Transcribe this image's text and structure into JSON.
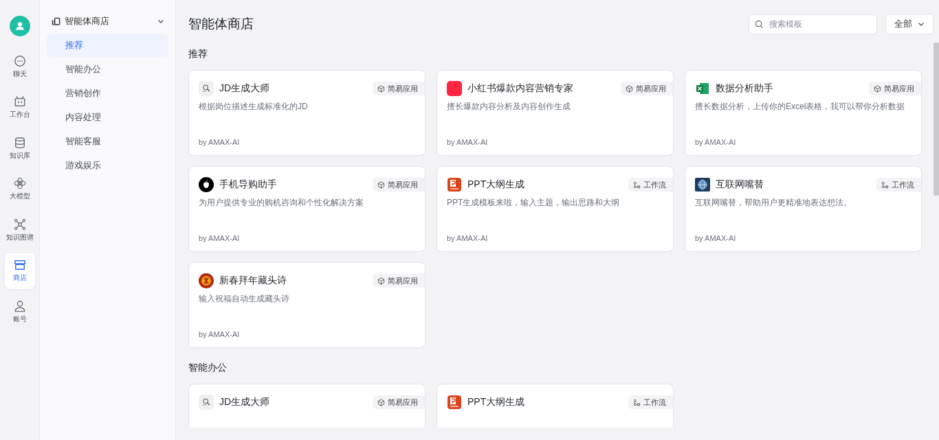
{
  "rail": {
    "items": [
      {
        "kind": "chat",
        "label": "聊天",
        "selected": false
      },
      {
        "kind": "robot",
        "label": "工作台",
        "selected": false
      },
      {
        "kind": "database",
        "label": "知识库",
        "selected": false
      },
      {
        "kind": "model",
        "label": "大模型",
        "selected": false
      },
      {
        "kind": "graph",
        "label": "知识图谱",
        "selected": false
      },
      {
        "kind": "store",
        "label": "商店",
        "selected": true
      },
      {
        "kind": "user",
        "label": "账号",
        "selected": false
      }
    ]
  },
  "sidebar": {
    "title": "智能体商店",
    "expanded": true,
    "items": [
      {
        "label": "推荐",
        "selected": true
      },
      {
        "label": "智能办公",
        "selected": false
      },
      {
        "label": "营销创作",
        "selected": false
      },
      {
        "label": "内容处理",
        "selected": false
      },
      {
        "label": "智能客服",
        "selected": false
      },
      {
        "label": "游戏娱乐",
        "selected": false
      }
    ]
  },
  "header": {
    "title": "智能体商店",
    "search": {
      "placeholder": "搜索模板"
    },
    "filter": "全部"
  },
  "sections": [
    {
      "title": "推荐",
      "cards": [
        {
          "kind": "jd",
          "title": "JD生成大师",
          "tag": {
            "kind": "app",
            "label": "简易应用"
          },
          "description": "根据岗位描述生成标准化的JD",
          "author": "by AMAX-AI"
        },
        {
          "kind": "xhs",
          "title": "小红书爆款内容营销专家",
          "tag": {
            "kind": "app",
            "label": "简易应用"
          },
          "description": "擅长爆款内容分析及内容创作生成",
          "author": "by AMAX-AI"
        },
        {
          "kind": "excel",
          "title": "数据分析助手",
          "tag": {
            "kind": "app",
            "label": "简易应用"
          },
          "description": "擅长数据分析，上传你的Excel表格，我可以帮你分析数据",
          "author": "by AMAX-AI"
        },
        {
          "kind": "apple",
          "title": "手机导购助手",
          "tag": {
            "kind": "app",
            "label": "简易应用"
          },
          "description": "为用户提供专业的购机咨询和个性化解决方案",
          "author": "by AMAX-AI"
        },
        {
          "kind": "ppt",
          "title": "PPT大纲生成",
          "tag": {
            "kind": "workflow",
            "label": "工作流"
          },
          "description": "PPT生成模板来啦，输入主题，输出思路和大纲",
          "author": "by AMAX-AI"
        },
        {
          "kind": "globe",
          "title": "互联网嘴替",
          "tag": {
            "kind": "workflow",
            "label": "工作流"
          },
          "description": "互联网嘴替，帮助用户更精准地表达想法。",
          "author": "by AMAX-AI"
        },
        {
          "kind": "fortune",
          "title": "新春拜年藏头诗",
          "tag": {
            "kind": "app",
            "label": "简易应用"
          },
          "description": "输入祝福自动生成藏头诗",
          "author": "by AMAX-AI"
        }
      ]
    },
    {
      "title": "智能办公",
      "cards": [
        {
          "kind": "jd",
          "title": "JD生成大师",
          "tag": {
            "kind": "app",
            "label": "简易应用"
          }
        },
        {
          "kind": "ppt",
          "title": "PPT大纲生成",
          "tag": {
            "kind": "workflow",
            "label": "工作流"
          }
        }
      ]
    }
  ]
}
